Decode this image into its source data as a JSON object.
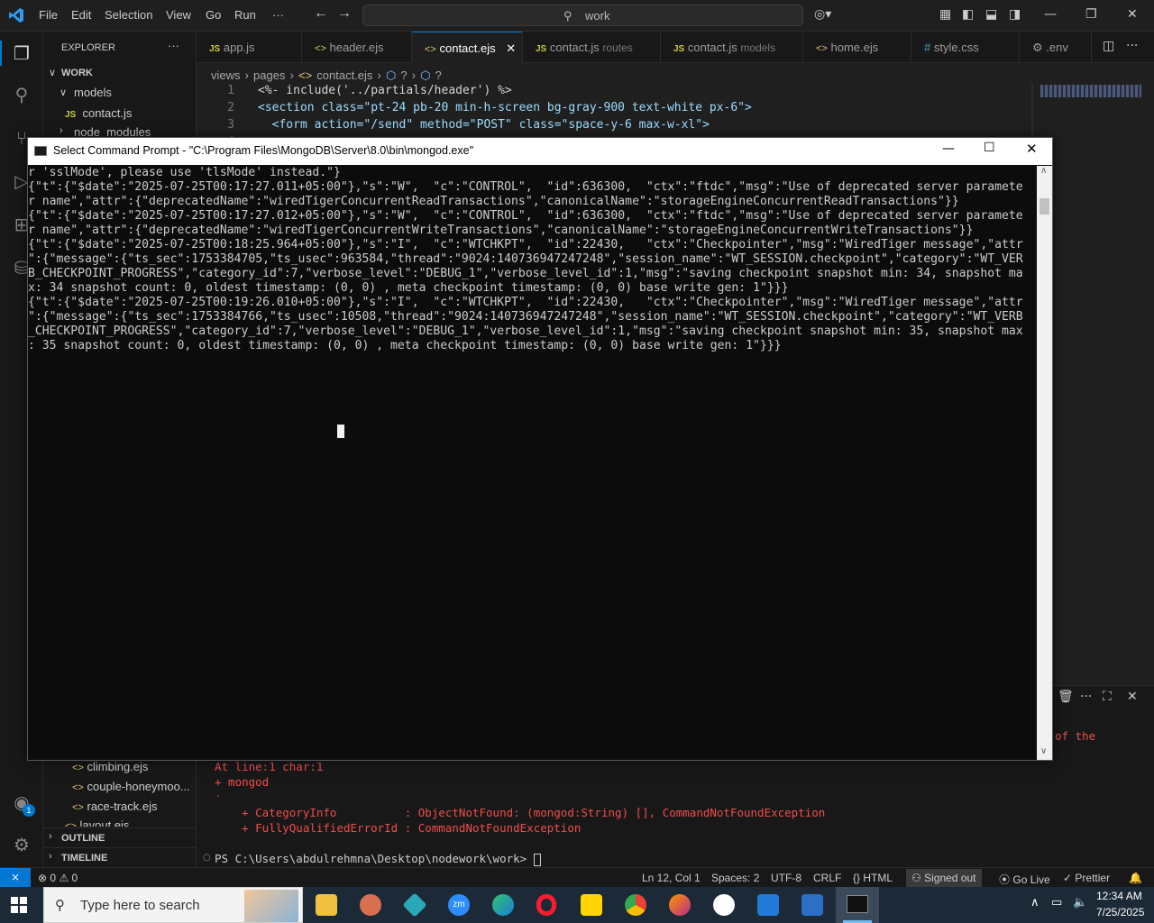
{
  "titlebar": {
    "menus": [
      "File",
      "Edit",
      "Selection",
      "View",
      "Go",
      "Run",
      "···"
    ],
    "search": "work"
  },
  "explorer": {
    "header": "EXPLORER",
    "root": "WORK",
    "items": [
      "models",
      "contact.js",
      "node_modules"
    ],
    "lower_items": [
      "climbing.ejs",
      "couple-honeymoo...",
      "race-track.ejs",
      "layout.ejs"
    ],
    "outline": "OUTLINE",
    "timeline": "TIMELINE"
  },
  "tabs": [
    {
      "label": "app.js",
      "sub": ""
    },
    {
      "label": "header.ejs",
      "sub": ""
    },
    {
      "label": "contact.ejs",
      "sub": ""
    },
    {
      "label": "contact.js",
      "sub": "routes"
    },
    {
      "label": "contact.js",
      "sub": "models"
    },
    {
      "label": "home.ejs",
      "sub": ""
    },
    {
      "label": "style.css",
      "sub": ""
    },
    {
      "label": ".env",
      "sub": ""
    }
  ],
  "breadcrumb": [
    "views",
    "pages",
    "contact.ejs",
    "?",
    "?"
  ],
  "code": [
    {
      "n": "1",
      "text": "<%- include('../partials/header') %>"
    },
    {
      "n": "2",
      "text": "<section class=\"pt-24 pb-20 min-h-screen bg-gray-900 text-white px-6\">"
    },
    {
      "n": "3",
      "text": "  <form action=\"/send\" method=\"POST\" class=\"space-y-6 max-w-xl\">"
    },
    {
      "n": "4",
      "text": ""
    }
  ],
  "cmd": {
    "title": "Select Command Prompt - \"C:\\Program Files\\MongoDB\\Server\\8.0\\bin\\mongod.exe\"",
    "lines": [
      "r 'sslMode', please use 'tlsMode' instead.\"}",
      "{\"t\":{\"$date\":\"2025-07-25T00:17:27.011+05:00\"},\"s\":\"W\",  \"c\":\"CONTROL\",  \"id\":636300,  \"ctx\":\"ftdc\",\"msg\":\"Use of deprecated server paramete",
      "r name\",\"attr\":{\"deprecatedName\":\"wiredTigerConcurrentReadTransactions\",\"canonicalName\":\"storageEngineConcurrentReadTransactions\"}}",
      "{\"t\":{\"$date\":\"2025-07-25T00:17:27.012+05:00\"},\"s\":\"W\",  \"c\":\"CONTROL\",  \"id\":636300,  \"ctx\":\"ftdc\",\"msg\":\"Use of deprecated server paramete",
      "r name\",\"attr\":{\"deprecatedName\":\"wiredTigerConcurrentWriteTransactions\",\"canonicalName\":\"storageEngineConcurrentWriteTransactions\"}}",
      "{\"t\":{\"$date\":\"2025-07-25T00:18:25.964+05:00\"},\"s\":\"I\",  \"c\":\"WTCHKPT\",  \"id\":22430,   \"ctx\":\"Checkpointer\",\"msg\":\"WiredTiger message\",\"attr",
      "\":{\"message\":{\"ts_sec\":1753384705,\"ts_usec\":963584,\"thread\":\"9024:140736947247248\",\"session_name\":\"WT_SESSION.checkpoint\",\"category\":\"WT_VER",
      "B_CHECKPOINT_PROGRESS\",\"category_id\":7,\"verbose_level\":\"DEBUG_1\",\"verbose_level_id\":1,\"msg\":\"saving checkpoint snapshot min: 34, snapshot ma",
      "x: 34 snapshot count: 0, oldest timestamp: (0, 0) , meta checkpoint timestamp: (0, 0) base write gen: 1\"}}}",
      "{\"t\":{\"$date\":\"2025-07-25T00:19:26.010+05:00\"},\"s\":\"I\",  \"c\":\"WTCHKPT\",  \"id\":22430,   \"ctx\":\"Checkpointer\",\"msg\":\"WiredTiger message\",\"attr",
      "\":{\"message\":{\"ts_sec\":1753384766,\"ts_usec\":10508,\"thread\":\"9024:140736947247248\",\"session_name\":\"WT_SESSION.checkpoint\",\"category\":\"WT_VERB",
      "_CHECKPOINT_PROGRESS\",\"category_id\":7,\"verbose_level\":\"DEBUG_1\",\"verbose_level_id\":1,\"msg\":\"saving checkpoint snapshot min: 35, snapshot max",
      ": 35 snapshot count: 0, oldest timestamp: (0, 0) , meta checkpoint timestamp: (0, 0) base write gen: 1\"}}}"
    ]
  },
  "terminal": {
    "partial": "of the",
    "error_lines": [
      "At line:1 char:1",
      "+ mongod",
      "+ ~~~~~~",
      "    + CategoryInfo          : ObjectNotFound: (mongod:String) [], CommandNotFoundException",
      "    + FullyQualifiedErrorId : CommandNotFoundException"
    ],
    "prompt": "PS C:\\Users\\abdulrehmna\\Desktop\\nodework\\work> "
  },
  "status": {
    "errors": "0",
    "warnings": "0",
    "position": "Ln 12, Col 1",
    "spaces": "Spaces: 2",
    "encoding": "UTF-8",
    "eol": "CRLF",
    "language": "HTML",
    "signed": "Signed out",
    "golive": "Go Live",
    "prettier": "Prettier"
  },
  "taskbar": {
    "search_placeholder": "Type here to search",
    "time": "12:34 AM",
    "date": "7/25/2025"
  },
  "colors": {
    "accent": "#0078d4",
    "error": "#f14c4c",
    "string": "#ce9178",
    "attr": "#9cdcfe",
    "tag": "#569cd6"
  }
}
